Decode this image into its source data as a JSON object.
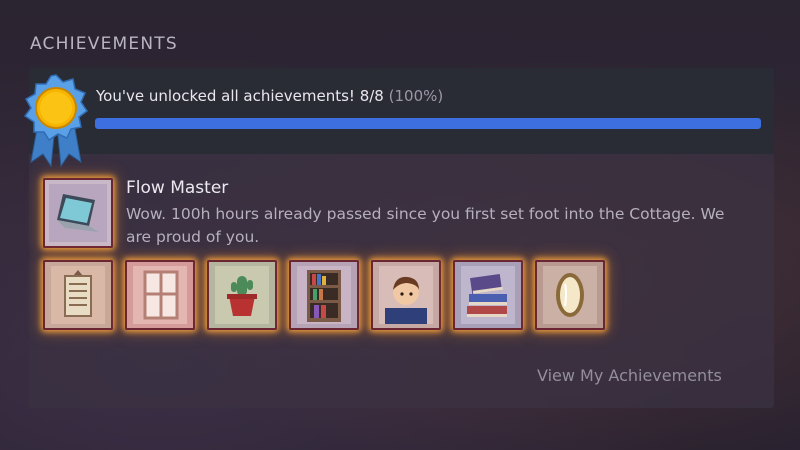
{
  "section": {
    "title": "ACHIEVEMENTS"
  },
  "summary": {
    "text": "You've unlocked all achievements! 8/8",
    "percent": "(100%)",
    "progress_fraction": 1.0
  },
  "featured": {
    "title": "Flow Master",
    "description": "Wow. 100h hours already passed since you first set foot into the Cottage. We are proud of you.",
    "icon": "laptop-icon"
  },
  "achievements": [
    {
      "icon": "wall-scroll-icon"
    },
    {
      "icon": "window-icon"
    },
    {
      "icon": "potted-cactus-icon"
    },
    {
      "icon": "bookshelf-icon"
    },
    {
      "icon": "character-portrait-icon"
    },
    {
      "icon": "book-stack-icon"
    },
    {
      "icon": "mirror-icon"
    }
  ],
  "view_link": "View My Achievements",
  "colors": {
    "progress": "#3d6fe0",
    "tile_glow": "#ffaa3c",
    "ribbon": "#4b8fd6",
    "medal": "#f7b500"
  }
}
